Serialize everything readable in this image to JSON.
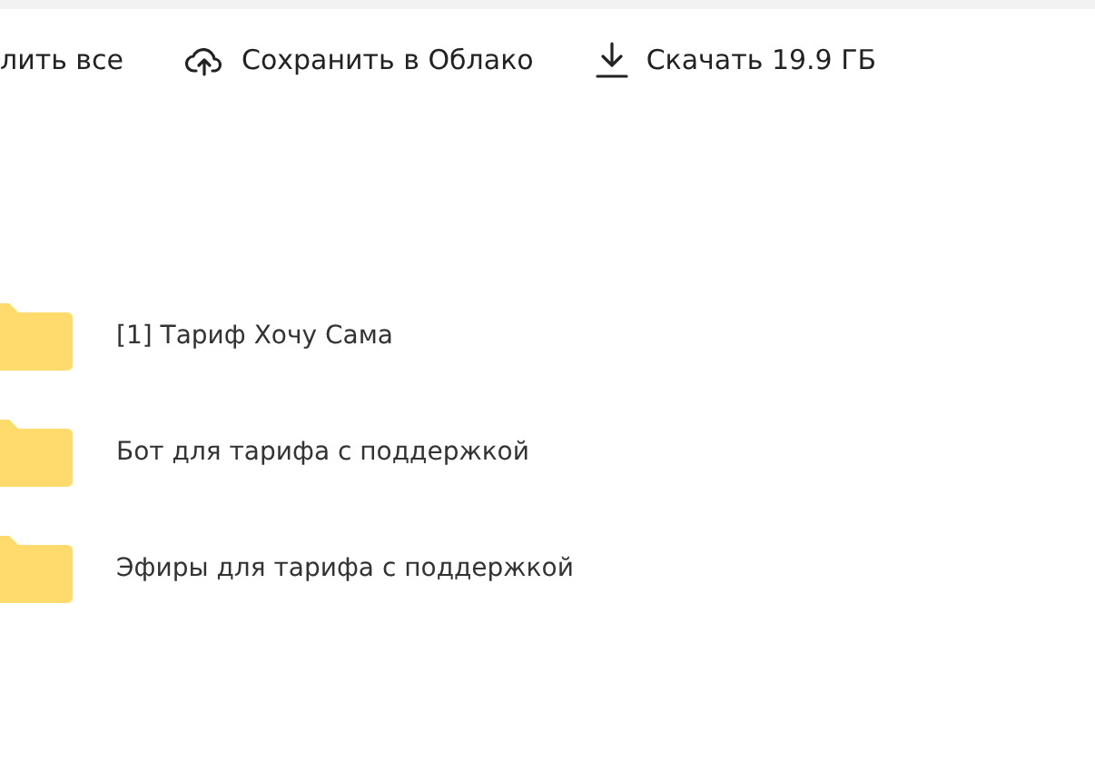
{
  "toolbar": [
    {
      "kind": "plain",
      "label": "лить все"
    },
    {
      "kind": "cloud",
      "label": "Сохранить в Облако"
    },
    {
      "kind": "download",
      "label": "Скачать 19.9 ГБ"
    }
  ],
  "folders": [
    {
      "name": "[1] Тариф Хочу Сама"
    },
    {
      "name": "Бот для тарифа с поддержкой"
    },
    {
      "name": "Эфиры для тарифа с поддержкой"
    }
  ]
}
